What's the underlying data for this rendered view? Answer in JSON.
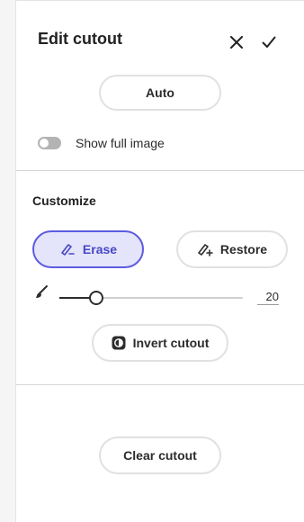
{
  "header": {
    "title": "Edit cutout",
    "close_icon": "close-icon",
    "confirm_icon": "checkmark-icon"
  },
  "auto_button": {
    "label": "Auto"
  },
  "show_full_image": {
    "label": "Show full image",
    "checked": false
  },
  "customize": {
    "title": "Customize",
    "erase": {
      "label": "Erase",
      "icon": "erase-brush-icon",
      "active": true
    },
    "restore": {
      "label": "Restore",
      "icon": "restore-brush-icon",
      "active": false
    },
    "brush_size": {
      "icon": "brush-icon",
      "value": "20",
      "level_fraction": 0.2
    },
    "invert": {
      "label": "Invert cutout",
      "icon": "invert-cutout-icon"
    }
  },
  "clear_button": {
    "label": "Clear cutout"
  },
  "colors": {
    "accent": "#4646c6",
    "accent_bg": "#e4e4fb",
    "accent_border": "#5c5ce0",
    "divider": "#d6d6d6"
  }
}
